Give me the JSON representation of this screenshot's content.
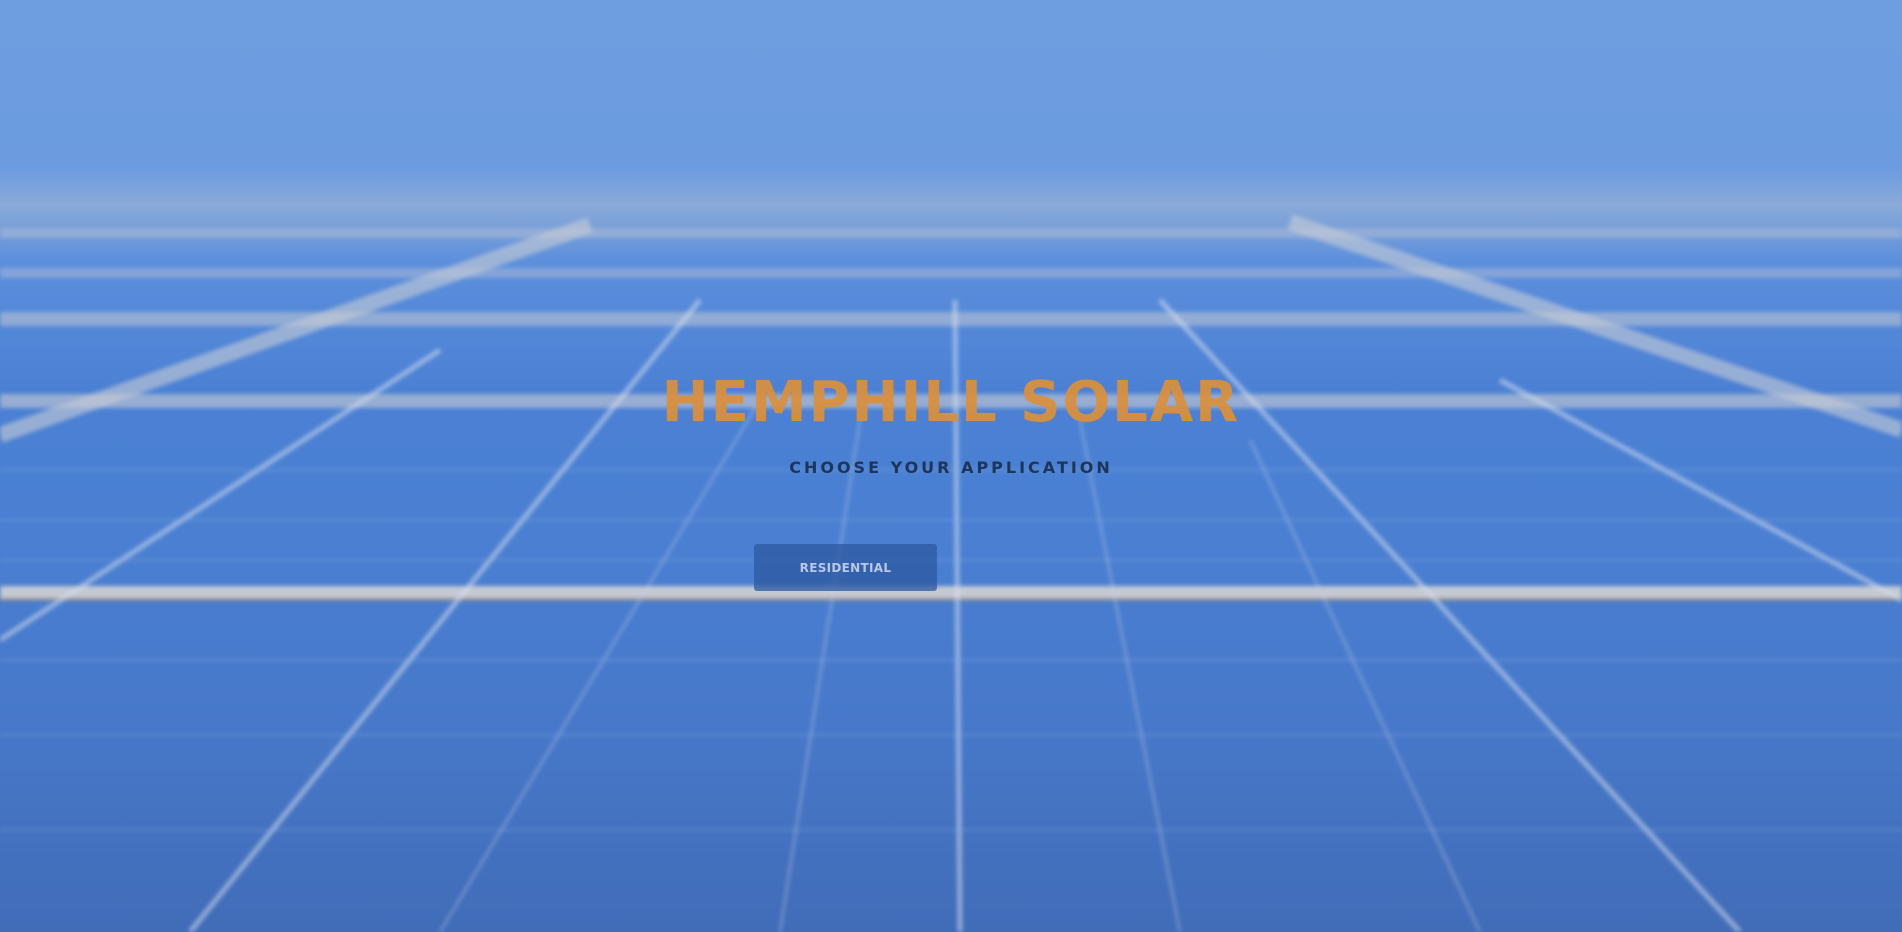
{
  "hero": {
    "title": "HEMPHILL SOLAR",
    "subtitle": "CHOOSE YOUR APPLICATION",
    "buttons": [
      {
        "label": "RESIDENTIAL"
      }
    ]
  },
  "colors": {
    "title": "#d89040",
    "subtitle": "#1c3558",
    "sky": "#6e9ee0",
    "panel": "#4a7fd2",
    "button_bg": "#2e58a0",
    "button_text": "#b9c8e6"
  }
}
